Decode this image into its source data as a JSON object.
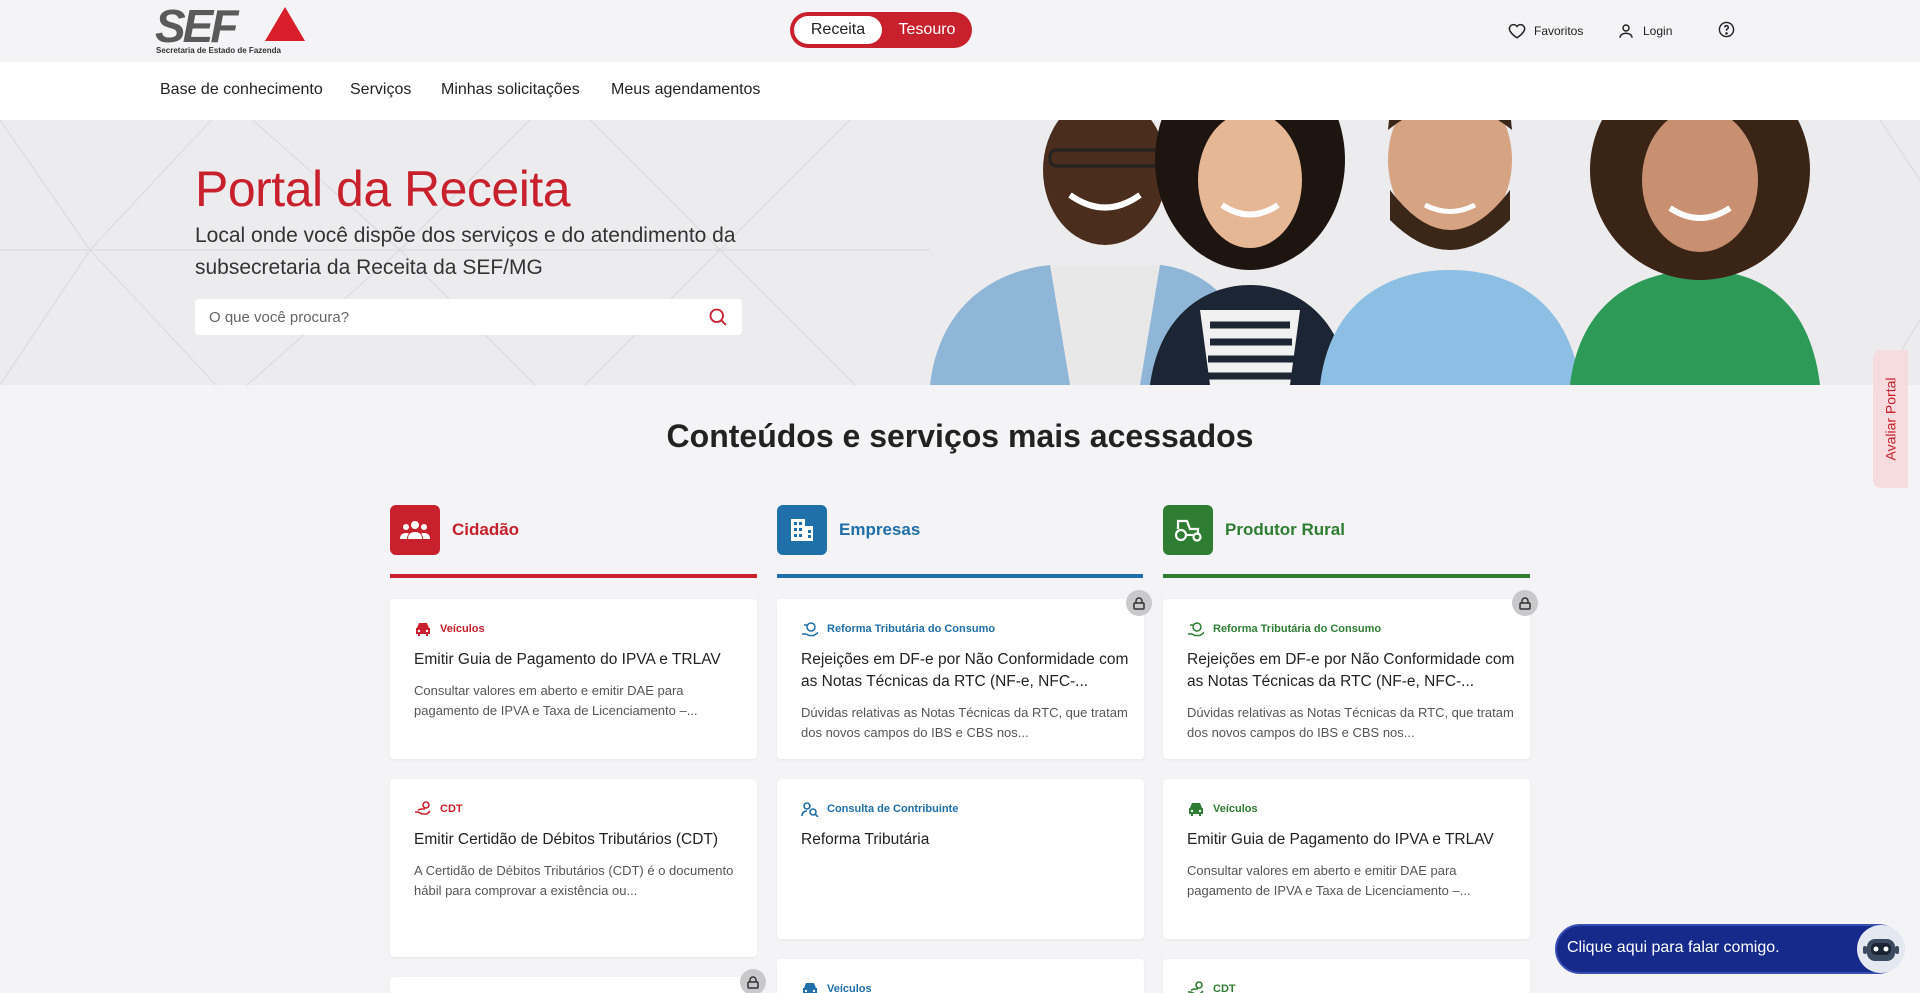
{
  "header": {
    "logo_text": "SEF",
    "logo_subtitle": "Secretaria de Estado de Fazenda",
    "toggle": {
      "active": "Receita",
      "inactive": "Tesouro"
    },
    "favorites_label": "Favoritos",
    "login_label": "Login"
  },
  "nav": {
    "items": [
      "Base de conhecimento",
      "Serviços",
      "Minhas solicitações",
      "Meus agendamentos"
    ]
  },
  "hero": {
    "title": "Portal da Receita",
    "subtitle": "Local onde você dispõe dos serviços e do atendimento da subsecretaria da Receita da SEF/MG",
    "search_placeholder": "O que você procura?"
  },
  "rate_tab": "Avaliar Portal",
  "section_title": "Conteúdos e serviços mais acessados",
  "columns": [
    {
      "label": "Cidadão",
      "color": "#c8202c",
      "cards": [
        {
          "category": "Veículos",
          "title": "Emitir Guia de Pagamento do IPVA e TRLAV",
          "desc": "Consultar valores em aberto e emitir DAE para pagamento de IPVA e Taxa de Licenciamento –..."
        },
        {
          "category": "CDT",
          "title": "Emitir Certidão de Débitos Tributários (CDT)",
          "desc": "A Certidão de Débitos Tributários (CDT) é o documento hábil para comprovar a existência ou..."
        }
      ]
    },
    {
      "label": "Empresas",
      "color": "#1f6fa8",
      "cards": [
        {
          "category": "Reforma Tributária do Consumo",
          "title": "Rejeições em DF-e por Não Conformidade com as Notas Técnicas da RTC (NF-e, NFC-...",
          "desc": "Dúvidas relativas as Notas Técnicas da RTC, que tratam dos novos campos do IBS e CBS nos..."
        },
        {
          "category": "Consulta de Contribuinte",
          "title": "Reforma Tributária",
          "desc": ""
        },
        {
          "category": "Veículos",
          "title": "",
          "desc": ""
        }
      ]
    },
    {
      "label": "Produtor Rural",
      "color": "#2f7d32",
      "cards": [
        {
          "category": "Reforma Tributária do Consumo",
          "title": "Rejeições em DF-e por Não Conformidade com as Notas Técnicas da RTC (NF-e, NFC-...",
          "desc": "Dúvidas relativas as Notas Técnicas da RTC, que tratam dos novos campos do IBS e CBS nos..."
        },
        {
          "category": "Veículos",
          "title": "Emitir Guia de Pagamento do IPVA e TRLAV",
          "desc": "Consultar valores em aberto e emitir DAE para pagamento de IPVA e Taxa de Licenciamento –..."
        },
        {
          "category": "CDT",
          "title": "",
          "desc": ""
        }
      ]
    }
  ],
  "chat": {
    "label": "Clique aqui para falar comigo."
  }
}
